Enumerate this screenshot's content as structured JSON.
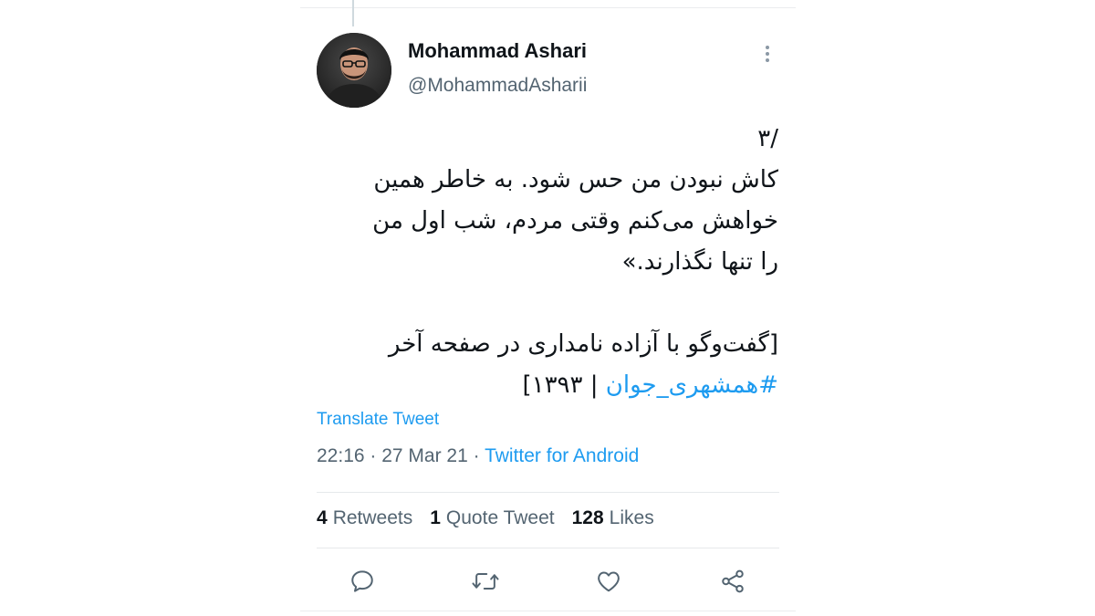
{
  "tweet": {
    "author": {
      "name": "Mohammad Ashari",
      "handle": "@MohammadAsharii"
    },
    "body_lines": [
      "/۳",
      "کاش نبودن من حس شود. به خاطر همین",
      "خواهش می‌کنم وقتی مردم، شب اول من",
      "را تنها نگذارند.»",
      "",
      "[گفت‌وگو با آزاده نامداری در صفحه آخر"
    ],
    "last_line": {
      "hashtag": "#همشهری_جوان",
      "rest": " | ۱۳۹۳]"
    },
    "translate_label": "Translate Tweet",
    "timestamp": "22:16 · 27 Mar 21 · ",
    "source": "Twitter for Android",
    "stats": {
      "retweets_count": "4",
      "retweets_label": "Retweets",
      "quotes_count": "1",
      "quotes_label": "Quote Tweet",
      "likes_count": "128",
      "likes_label": "Likes"
    }
  },
  "icons": {
    "more": "more-vertical-icon",
    "reply": "reply-icon",
    "retweet": "retweet-icon",
    "like": "heart-icon",
    "share": "share-icon"
  },
  "colors": {
    "accent": "#1d9bf0",
    "text_primary": "#0f1419",
    "text_secondary": "#536471",
    "divider": "#e6e9eb"
  }
}
